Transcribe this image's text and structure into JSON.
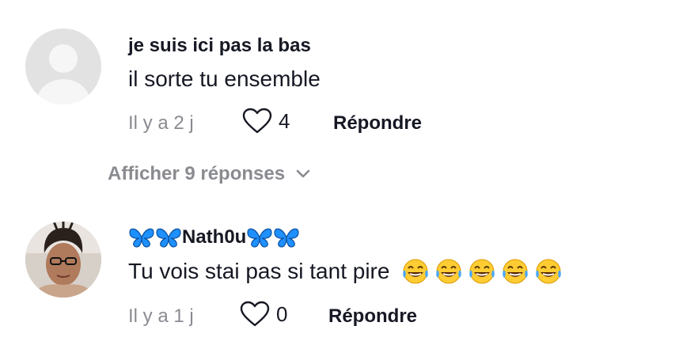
{
  "comments": [
    {
      "username": "je suis ici pas la bas",
      "text": "il sorte tu ensemble",
      "time": "Il y a 2 j",
      "likes": "4",
      "reply_label": "Répondre"
    },
    {
      "username": "Nath0u",
      "text": "Tu vois stai pas si tant pire",
      "time": "Il y a 1 j",
      "likes": "0",
      "reply_label": "Répondre",
      "emojis": [
        "😂",
        "😂",
        "😂",
        "😂",
        "😂"
      ]
    }
  ],
  "view_replies_label": "Afficher 9 réponses",
  "colors": {
    "primary_text": "#161823",
    "secondary_text": "#8a8b91",
    "butterfly": "#1e90ff"
  },
  "icons": [
    "default-avatar-icon",
    "heart-outline-icon",
    "chevron-down-icon",
    "butterfly-emoji-icon",
    "laughing-emoji-icon"
  ]
}
